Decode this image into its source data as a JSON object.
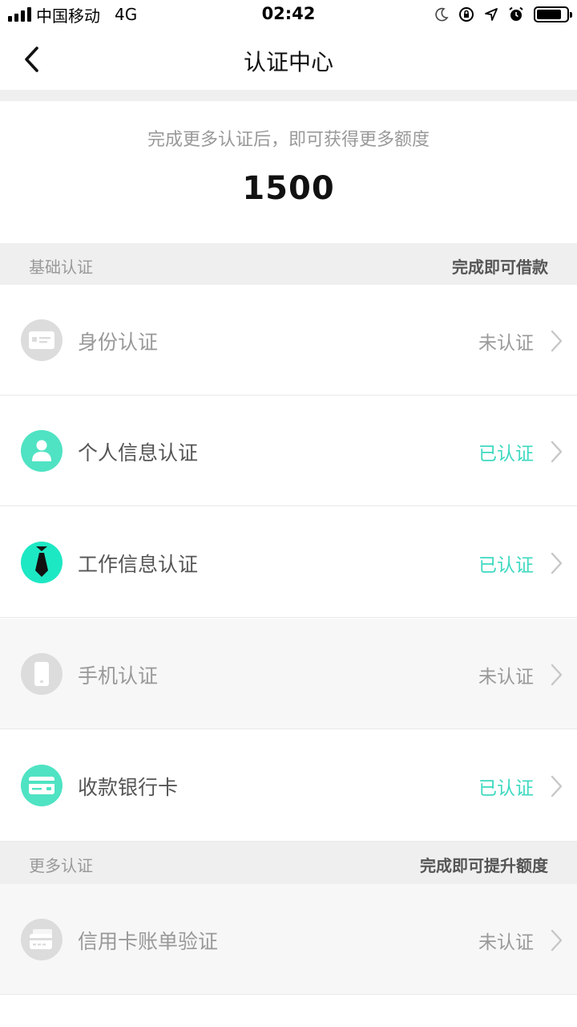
{
  "status_bar": {
    "carrier": "中国移动",
    "network": "4G",
    "time": "02:42"
  },
  "nav": {
    "title": "认证中心",
    "back_icon": "chevron-left-icon"
  },
  "credit": {
    "hint": "完成更多认证后，即可获得更多额度",
    "amount": "1500"
  },
  "sections": [
    {
      "title": "基础认证",
      "note": "完成即可借款"
    },
    {
      "title": "更多认证",
      "note": "完成即可提升额度"
    }
  ],
  "items": [
    {
      "label": "身份认证",
      "status": "未认证",
      "icon": "id-card-icon",
      "verified": false
    },
    {
      "label": "个人信息认证",
      "status": "已认证",
      "icon": "person-icon",
      "verified": true
    },
    {
      "label": "工作信息认证",
      "status": "已认证",
      "icon": "tie-icon",
      "verified": true
    },
    {
      "label": "手机认证",
      "status": "未认证",
      "icon": "phone-icon",
      "verified": false
    },
    {
      "label": "收款银行卡",
      "status": "已认证",
      "icon": "bank-card-icon",
      "verified": true
    },
    {
      "label": "信用卡账单验证",
      "status": "未认证",
      "icon": "credit-card-bill-icon",
      "verified": false
    }
  ],
  "colors": {
    "verified": "#3dd9c1",
    "icon_green": "#4fe3c3",
    "icon_gray": "#dcdcdc",
    "section_bg": "#efefef"
  }
}
